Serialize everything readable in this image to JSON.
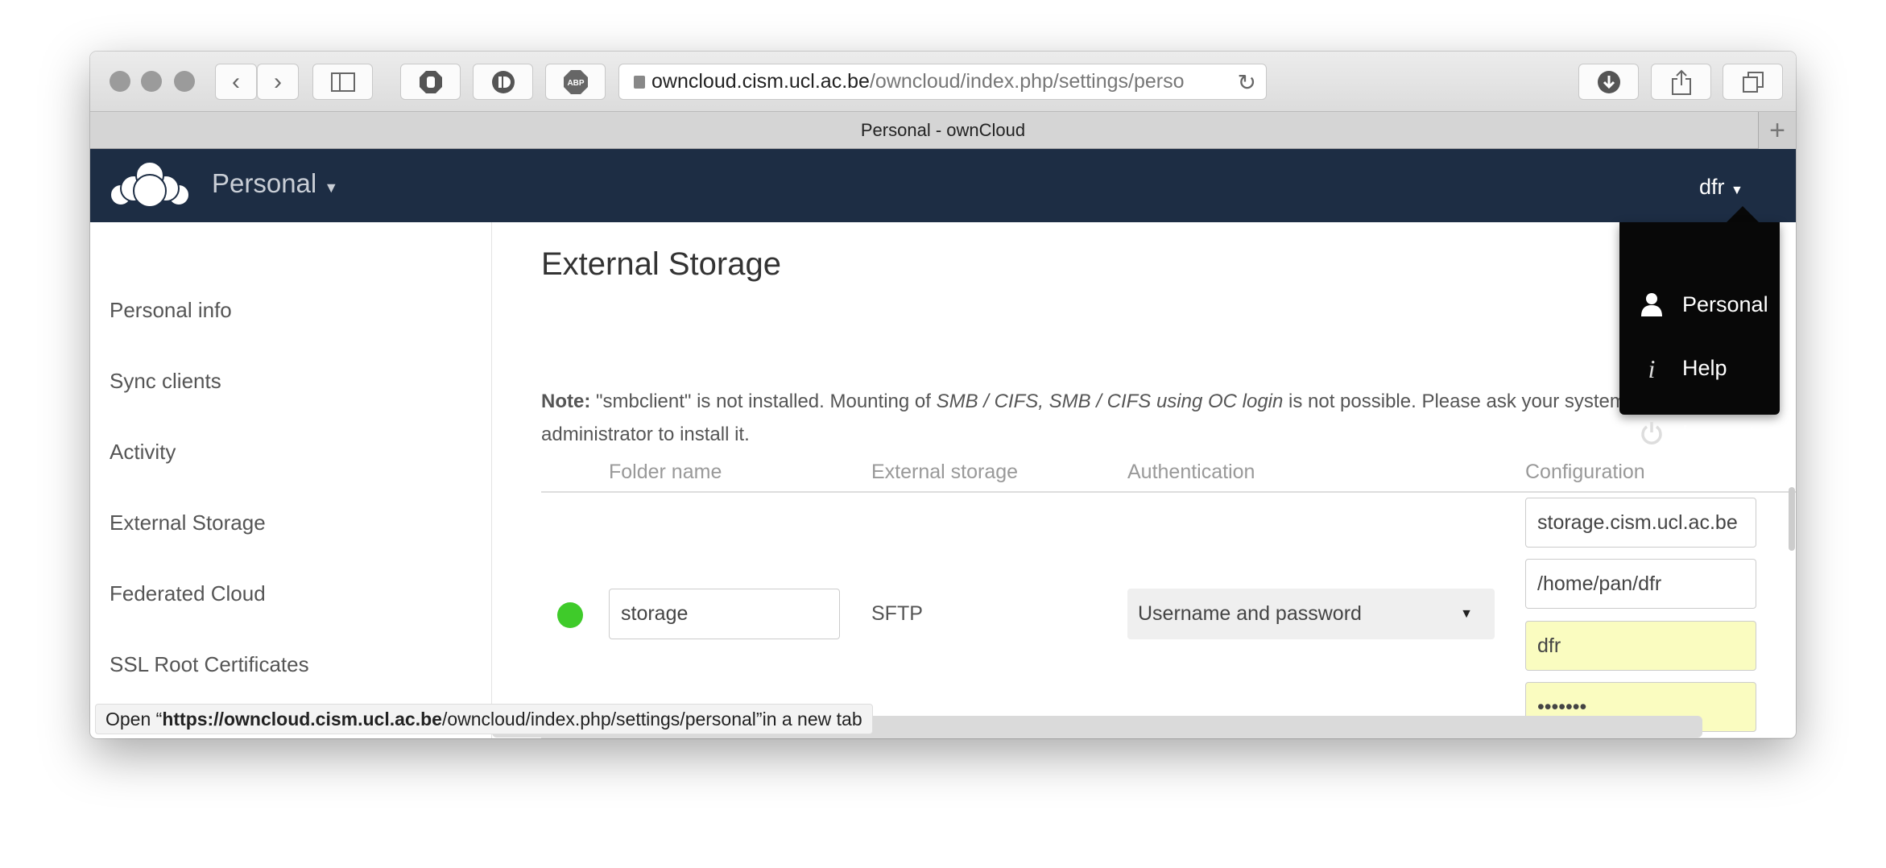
{
  "browser": {
    "url_host": "owncloud.cism.ucl.ac.be",
    "url_path": "/owncloud/index.php/settings/perso",
    "tab_title": "Personal - ownCloud",
    "new_tab": "+",
    "extensions": [
      "ublock",
      "1password",
      "ABP"
    ]
  },
  "header": {
    "app_name": "Personal",
    "user": "dfr",
    "bg": "#1d2d44"
  },
  "user_menu": {
    "items": [
      {
        "label": "Personal",
        "icon": "user-icon"
      },
      {
        "label": "Help",
        "icon": "info-icon"
      },
      {
        "label": "Log out",
        "icon": "power-icon"
      }
    ]
  },
  "sidebar": {
    "items": [
      {
        "label": "Personal info"
      },
      {
        "label": "Sync clients"
      },
      {
        "label": "Activity"
      },
      {
        "label": "External Storage"
      },
      {
        "label": "Federated Cloud"
      },
      {
        "label": "SSL Root Certificates"
      }
    ]
  },
  "main": {
    "title": "External Storage",
    "note_bold": "Note:",
    "note_1": " \"smbclient\" is not installed. Mounting of ",
    "note_em": "SMB / CIFS, SMB / CIFS using OC login",
    "note_2": " is not possible. Please ask your system",
    "note_3": "administrator to install it.",
    "columns": [
      "Folder name",
      "External storage",
      "Authentication",
      "Configuration"
    ],
    "row": {
      "status_color": "#3fcb2a",
      "folder_name": "storage",
      "storage": "SFTP",
      "auth": "Username and password",
      "config": [
        "storage.cism.ucl.ac.be",
        "/home/pan/dfr",
        "dfr",
        "•••••••"
      ]
    }
  },
  "status_bar": {
    "prefix": "Open “",
    "bold": "https://owncloud.cism.ucl.ac.be",
    "rest": "/owncloud/index.php/settings/personal”",
    "suffix": " in a new tab"
  }
}
